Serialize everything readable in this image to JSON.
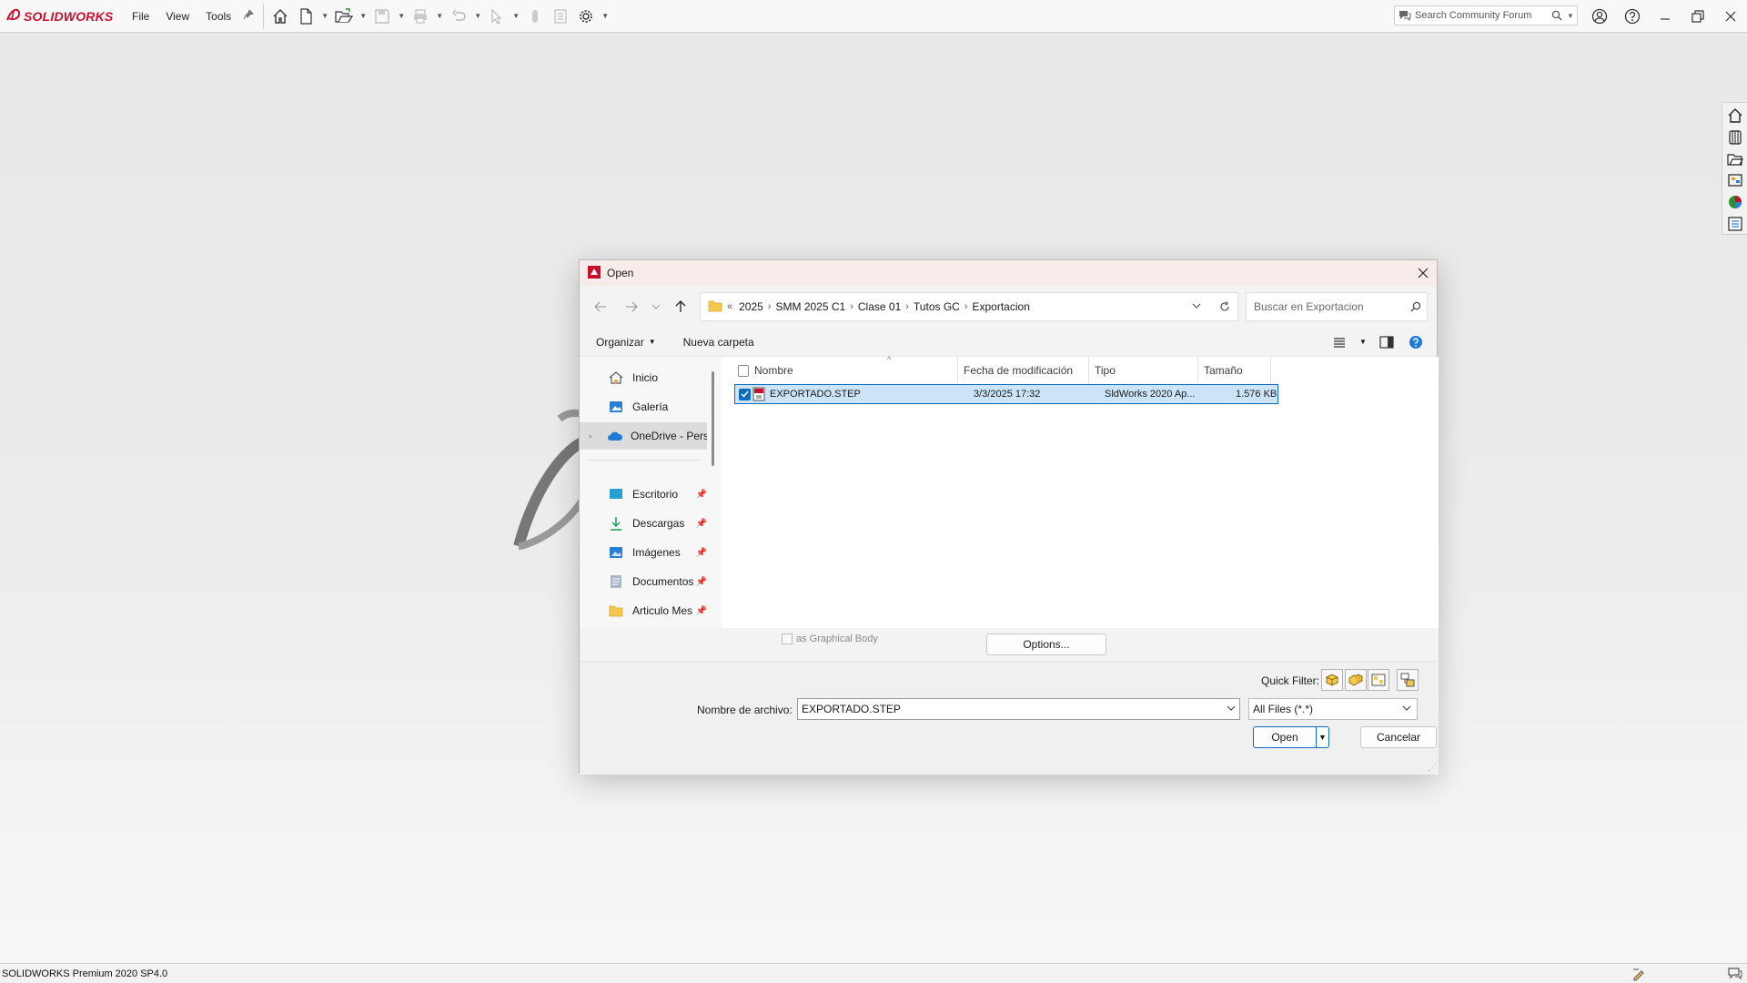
{
  "app": {
    "brand": "SOLIDWORKS",
    "menu": [
      "File",
      "View",
      "Tools"
    ],
    "search_placeholder": "Search Community Forum",
    "status_text": "SOLIDWORKS Premium 2020 SP4.0"
  },
  "dialog": {
    "title": "Open",
    "address": {
      "overflow": "«",
      "crumbs": [
        "2025",
        "SMM 2025 C1",
        "Clase 01",
        "Tutos GC",
        "Exportacion"
      ]
    },
    "search_placeholder": "Buscar en Exportacion",
    "commands": {
      "organize": "Organizar",
      "new_folder": "Nueva carpeta"
    },
    "nav_items": [
      {
        "label": "Inicio",
        "icon": "home-icon"
      },
      {
        "label": "Galería",
        "icon": "gallery-icon"
      },
      {
        "label": "OneDrive - Personal",
        "icon": "onedrive-icon"
      },
      {
        "label": "Escritorio",
        "icon": "desktop-icon"
      },
      {
        "label": "Descargas",
        "icon": "download-icon"
      },
      {
        "label": "Imágenes",
        "icon": "pictures-icon"
      },
      {
        "label": "Documentos",
        "icon": "documents-icon"
      },
      {
        "label": "Articulo Mes",
        "icon": "folder-icon"
      }
    ],
    "columns": {
      "name": "Nombre",
      "modified": "Fecha de modificación",
      "type": "Tipo",
      "size": "Tamaño"
    },
    "files": [
      {
        "name": "EXPORTADO.STEP",
        "modified": "3/3/2025 17:32",
        "type": "SldWorks 2020 Ap...",
        "size": "1.576 KB",
        "selected": true
      }
    ],
    "graphical_body_label": "as Graphical Body",
    "options_label": "Options...",
    "quick_filter_label": "Quick Filter:",
    "filename_label": "Nombre de archivo:",
    "filename_value": "EXPORTADO.STEP",
    "filter_value": "All Files (*.*)",
    "open_label": "Open",
    "cancel_label": "Cancelar"
  },
  "colors": {
    "accent": "#0f6cbd",
    "brand": "#c8102e",
    "selection": "#cce4f7"
  }
}
